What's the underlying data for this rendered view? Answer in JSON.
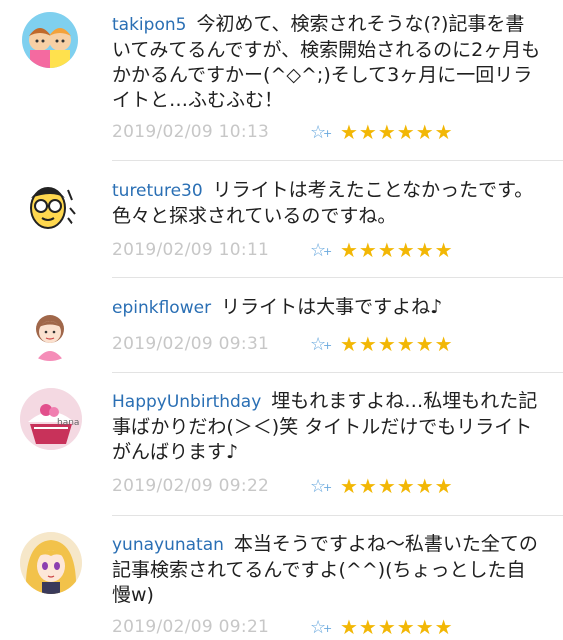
{
  "comments": [
    {
      "user": "takipon5",
      "text": "今初めて、検索されそうな(?)記事を書いてみてるんですが、検索開始されるのに2ヶ月もかかるんですかー(^◇^;)そして3ヶ月に一回リライトと…ふむふむ！",
      "time": "2019/02/09 10:13",
      "add_star": "☆",
      "stars": "★★★★★★"
    },
    {
      "user": "tureture30",
      "text": "リライトは考えたことなかったです。 色々と探求されているのですね。",
      "time": "2019/02/09 10:11",
      "add_star": "☆",
      "stars": "★★★★★★"
    },
    {
      "user": "epinkflower",
      "text": "リライトは大事ですよね♪",
      "time": "2019/02/09 09:31",
      "add_star": "☆",
      "stars": "★★★★★★"
    },
    {
      "user": "HappyUnbirthday",
      "text": "埋もれますよね…私埋もれた記事ばかりだわ(＞＜)笑 タイトルだけでもリライトがんばります♪",
      "time": "2019/02/09 09:22",
      "add_star": "☆",
      "stars": "★★★★★★"
    },
    {
      "user": "yunayunatan",
      "text": "本当そうですよね〜私書いた全ての記事検索されてるんですよ(^^)(ちょっとした自慢w)",
      "time": "2019/02/09 09:21",
      "add_star": "☆",
      "stars": "★★★★★★"
    }
  ],
  "avatars": [
    {
      "icon": "two-kids-avatar-icon"
    },
    {
      "icon": "glasses-man-avatar-icon"
    },
    {
      "icon": "pink-girl-avatar-icon"
    },
    {
      "icon": "cupcake-avatar-icon",
      "label": "hana"
    },
    {
      "icon": "anime-girl-avatar-icon"
    }
  ],
  "colors": {
    "username": "#2a6fb4",
    "timestamp": "#c7c7c7",
    "star_filled": "#f2b705",
    "add_star": "#6aa9de"
  }
}
